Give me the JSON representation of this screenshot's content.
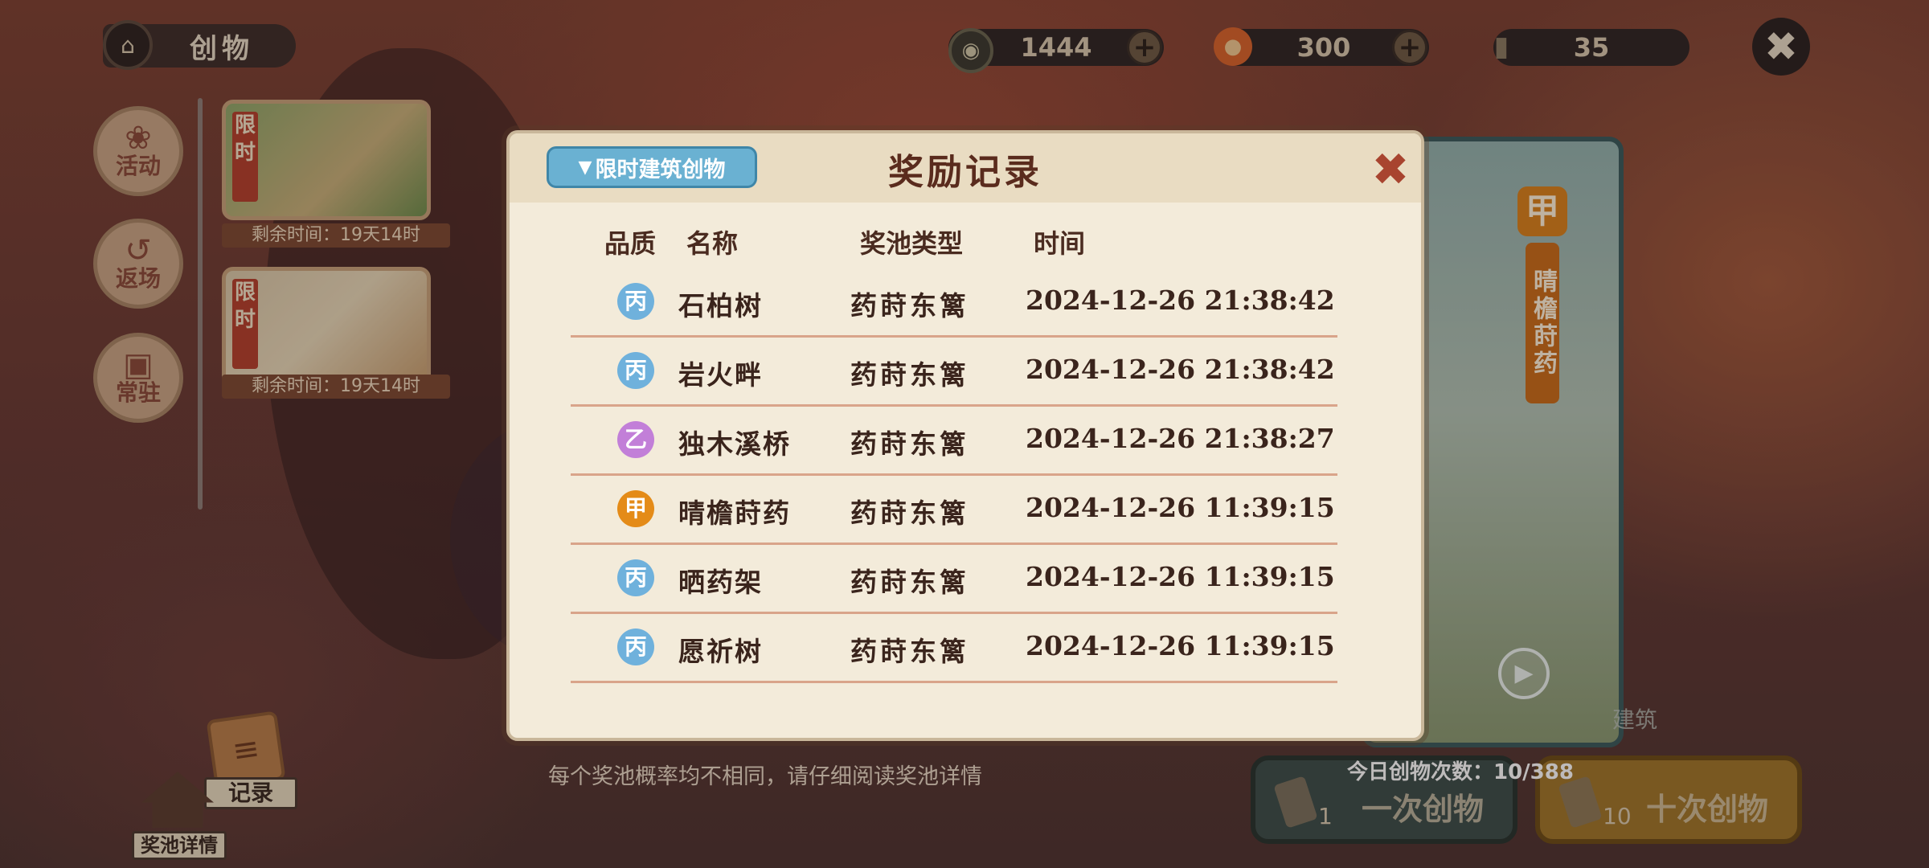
{
  "header": {
    "title": "创物"
  },
  "resources": {
    "coins": "1444",
    "peaches": "300",
    "scrolls": "35"
  },
  "nav": [
    {
      "label": "活动",
      "icon": "lion-head-icon"
    },
    {
      "label": "返场",
      "icon": "return-clock-icon"
    },
    {
      "label": "常驻",
      "icon": "treasure-box-icon"
    }
  ],
  "banners": [
    {
      "tag": "限时",
      "remaining": "剩余时间：19天14时"
    },
    {
      "tag": "限时",
      "remaining": "剩余时间：19天14时"
    }
  ],
  "bottom": {
    "record_label": "记录",
    "pool_detail_label": "奖池详情",
    "note": "每个奖池概率均不相同，请仔细阅读奖池详情",
    "daily": "今日创物次数：10/388",
    "single": {
      "label": "一次创物",
      "count": "1"
    },
    "ten": {
      "label": "十次创物",
      "count": "10"
    }
  },
  "side_card": {
    "grade": "甲",
    "name": "晴檐莳药",
    "building_label": "建筑"
  },
  "modal": {
    "title": "奖励记录",
    "filter_label": "限时建筑创物",
    "columns": {
      "quality": "品质",
      "name": "名称",
      "pool": "奖池类型",
      "time": "时间"
    },
    "rows": [
      {
        "quality": "丙",
        "name": "石柏树",
        "pool": "药莳东篱",
        "time": "2024-12-26 21:38:42"
      },
      {
        "quality": "丙",
        "name": "岩火畔",
        "pool": "药莳东篱",
        "time": "2024-12-26 21:38:42"
      },
      {
        "quality": "乙",
        "name": "独木溪桥",
        "pool": "药莳东篱",
        "time": "2024-12-26 21:38:27"
      },
      {
        "quality": "甲",
        "name": "晴檐莳药",
        "pool": "药莳东篱",
        "time": "2024-12-26 11:39:15"
      },
      {
        "quality": "丙",
        "name": "晒药架",
        "pool": "药莳东篱",
        "time": "2024-12-26 11:39:15"
      },
      {
        "quality": "丙",
        "name": "愿祈树",
        "pool": "药莳东篱",
        "time": "2024-12-26 11:39:15"
      }
    ]
  }
}
